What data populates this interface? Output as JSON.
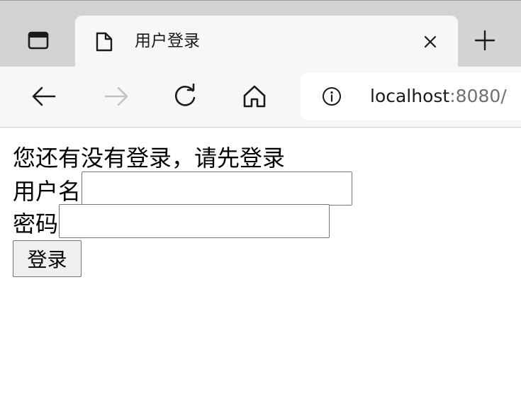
{
  "browser": {
    "tab": {
      "title": "用户登录",
      "close_glyph": "×",
      "icon": "page-icon"
    },
    "new_tab_glyph": "+",
    "address_bar": {
      "host": "localhost",
      "rest": ":8080/"
    }
  },
  "page": {
    "message": "您还有没有登录，请先登录",
    "username_label": "用户名",
    "username_value": "",
    "password_label": "密码",
    "password_value": "",
    "submit_label": "登录"
  }
}
